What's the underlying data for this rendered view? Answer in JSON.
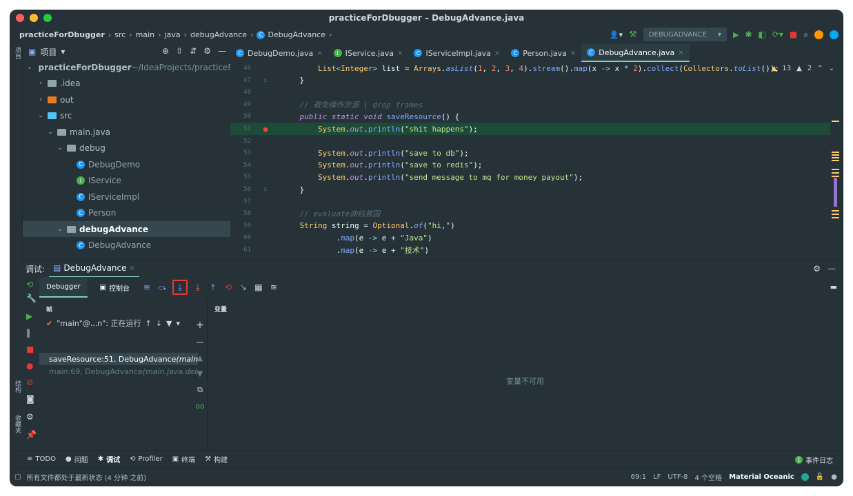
{
  "window": {
    "title": "practiceForDbugger – DebugAdvance.java"
  },
  "breadcrumb": {
    "items": [
      "practiceForDbugger",
      "src",
      "main",
      "java",
      "debugAdvance",
      "DebugAdvance"
    ]
  },
  "run_config": {
    "name": "DEBUGADVANCE"
  },
  "left_strip": {
    "project_label": "项目",
    "structure_label": "结构",
    "favorites_label": "收藏夹"
  },
  "right_strip": {
    "database_label": "数据库"
  },
  "project_panel": {
    "title": "项目",
    "tree": [
      {
        "label": "practiceForDbugger",
        "suffix": " ~/IdeaProjects/practiceForDbugger",
        "kind": "module",
        "expanded": "open"
      },
      {
        "label": ".idea",
        "kind": "folder",
        "expanded": "closed"
      },
      {
        "label": "out",
        "kind": "folder-orange",
        "expanded": "closed"
      },
      {
        "label": "src",
        "kind": "folder-blue",
        "expanded": "open"
      },
      {
        "label": "main.java",
        "kind": "package",
        "expanded": "open"
      },
      {
        "label": "debug",
        "kind": "package",
        "expanded": "open"
      },
      {
        "label": "DebugDemo",
        "kind": "class-run"
      },
      {
        "label": "IService",
        "kind": "interface"
      },
      {
        "label": "IServiceImpl",
        "kind": "class"
      },
      {
        "label": "Person",
        "kind": "class"
      },
      {
        "label": "debugAdvance",
        "kind": "package",
        "expanded": "open"
      },
      {
        "label": "DebugAdvance",
        "kind": "class-run"
      }
    ]
  },
  "editor": {
    "tabs": [
      {
        "label": "DebugDemo.java",
        "color": "#2196f3"
      },
      {
        "label": "IService.java",
        "color": "#4caf50"
      },
      {
        "label": "IServiceImpl.java",
        "color": "#2196f3"
      },
      {
        "label": "Person.java",
        "color": "#2196f3"
      },
      {
        "label": "DebugAdvance.java",
        "color": "#2196f3"
      }
    ],
    "warnings": {
      "warn_count": "13",
      "weak_count": "2"
    },
    "lines": [
      {
        "n": "46",
        "tokens": [
          [
            "",
            "        "
          ],
          [
            "ty",
            "List"
          ],
          [
            "op",
            "<"
          ],
          [
            "ty",
            "Integer"
          ],
          [
            "op",
            ">"
          ],
          [
            "",
            " list = "
          ],
          [
            "ty",
            "Arrays"
          ],
          [
            "",
            "."
          ],
          [
            "it",
            "asList"
          ],
          [
            "",
            "("
          ],
          [
            "nm",
            "1"
          ],
          [
            "",
            ", "
          ],
          [
            "nm",
            "2"
          ],
          [
            "",
            ", "
          ],
          [
            "nm",
            "3"
          ],
          [
            "",
            ", "
          ],
          [
            "nm",
            "4"
          ],
          [
            "",
            ")."
          ],
          [
            "fn",
            "stream"
          ],
          [
            "",
            "()."
          ],
          [
            "fn",
            "map"
          ],
          [
            "",
            "(x "
          ],
          [
            "op",
            "->"
          ],
          [
            "",
            " x "
          ],
          [
            "op",
            "*"
          ],
          [
            "",
            " "
          ],
          [
            "nm",
            "2"
          ],
          [
            "",
            ")."
          ],
          [
            "fn",
            "collect"
          ],
          [
            "",
            "("
          ],
          [
            "ty",
            "Collectors"
          ],
          [
            "",
            "."
          ],
          [
            "it",
            "toList"
          ],
          [
            "",
            "());"
          ]
        ]
      },
      {
        "n": "47",
        "tokens": [
          [
            "",
            "    }"
          ]
        ]
      },
      {
        "n": "48",
        "tokens": [
          [
            "",
            ""
          ]
        ]
      },
      {
        "n": "49",
        "tokens": [
          [
            "cm",
            "    // 避免操作资源 | drop frames"
          ]
        ]
      },
      {
        "n": "50",
        "tokens": [
          [
            "kw",
            "    public static void "
          ],
          [
            "fn",
            "saveResource"
          ],
          [
            "",
            "() {"
          ]
        ]
      },
      {
        "n": "51",
        "tokens": [
          [
            "",
            "        "
          ],
          [
            "ty",
            "System"
          ],
          [
            "",
            "."
          ],
          [
            "kw",
            "out"
          ],
          [
            "",
            "."
          ],
          [
            "fn",
            "println"
          ],
          [
            "",
            "("
          ],
          [
            "st",
            "\"shit happens\""
          ],
          [
            "",
            ");"
          ]
        ]
      },
      {
        "n": "52",
        "tokens": [
          [
            "",
            ""
          ]
        ]
      },
      {
        "n": "53",
        "tokens": [
          [
            "",
            "        "
          ],
          [
            "ty",
            "System"
          ],
          [
            "",
            "."
          ],
          [
            "kw",
            "out"
          ],
          [
            "",
            "."
          ],
          [
            "fn",
            "println"
          ],
          [
            "",
            "("
          ],
          [
            "st",
            "\"save to db\""
          ],
          [
            "",
            ");"
          ]
        ]
      },
      {
        "n": "54",
        "tokens": [
          [
            "",
            "        "
          ],
          [
            "ty",
            "System"
          ],
          [
            "",
            "."
          ],
          [
            "kw",
            "out"
          ],
          [
            "",
            "."
          ],
          [
            "fn",
            "println"
          ],
          [
            "",
            "("
          ],
          [
            "st",
            "\"save to redis\""
          ],
          [
            "",
            ");"
          ]
        ]
      },
      {
        "n": "55",
        "tokens": [
          [
            "",
            "        "
          ],
          [
            "ty",
            "System"
          ],
          [
            "",
            "."
          ],
          [
            "kw",
            "out"
          ],
          [
            "",
            "."
          ],
          [
            "fn",
            "println"
          ],
          [
            "",
            "("
          ],
          [
            "st",
            "\"send message to mq for money payout\""
          ],
          [
            "",
            ");"
          ]
        ]
      },
      {
        "n": "56",
        "tokens": [
          [
            "",
            "    }"
          ]
        ]
      },
      {
        "n": "57",
        "tokens": [
          [
            "",
            ""
          ]
        ]
      },
      {
        "n": "58",
        "tokens": [
          [
            "cm",
            "    // evaluate曲线救国"
          ]
        ]
      },
      {
        "n": "59",
        "tokens": [
          [
            "ty",
            "    String"
          ],
          [
            "",
            " string = "
          ],
          [
            "ty",
            "Optional"
          ],
          [
            "",
            "."
          ],
          [
            "it",
            "of"
          ],
          [
            "",
            "("
          ],
          [
            "st",
            "\"hi,\""
          ],
          [
            "",
            ")"
          ]
        ]
      },
      {
        "n": "60",
        "tokens": [
          [
            "",
            "            ."
          ],
          [
            "fn",
            "map"
          ],
          [
            "",
            "(e "
          ],
          [
            "op",
            "->"
          ],
          [
            "",
            " e + "
          ],
          [
            "st",
            "\"Java\""
          ],
          [
            "",
            ")"
          ]
        ]
      },
      {
        "n": "61",
        "tokens": [
          [
            "",
            "            ."
          ],
          [
            "fn",
            "map"
          ],
          [
            "",
            "(e "
          ],
          [
            "op",
            "->"
          ],
          [
            "",
            " e + "
          ],
          [
            "st",
            "\"技术\""
          ],
          [
            "",
            ")"
          ]
        ]
      }
    ]
  },
  "debug": {
    "header_label": "调试:",
    "session_tab": "DebugAdvance",
    "subtabs": {
      "debugger": "Debugger",
      "console": "控制台"
    },
    "frames_title": "帧",
    "thread": {
      "label": "\"main\"@...n\": 正在运行"
    },
    "frames": [
      {
        "label": "saveResource:51, DebugAdvance",
        "pkg": " (main.java.debugAdvance)"
      },
      {
        "label": "main:69, DebugAdvance",
        "pkg": " (main.java.debugAdvance)"
      }
    ],
    "variables_title": "变量",
    "variables_empty": "变量不可用"
  },
  "bottom_tools": {
    "items": [
      {
        "icon": "≡",
        "label": "TODO"
      },
      {
        "icon": "●",
        "label": "问题"
      },
      {
        "icon": "✱",
        "label": "调试"
      },
      {
        "icon": "⟲",
        "label": "Profiler"
      },
      {
        "icon": "▣",
        "label": "终端"
      },
      {
        "icon": "⚒",
        "label": "构建"
      }
    ],
    "event_log": "事件日志",
    "event_count": "1"
  },
  "status": {
    "message": "所有文件都处于最新状态 (4 分钟 之前)",
    "position": "69:1",
    "line_sep": "LF",
    "encoding": "UTF-8",
    "indent": "4 个空格",
    "theme": "Material Oceanic"
  },
  "colors": {
    "accent": "#80cbc4",
    "highlight_line": "#1e4a38",
    "breakpoint": "#f44336"
  }
}
